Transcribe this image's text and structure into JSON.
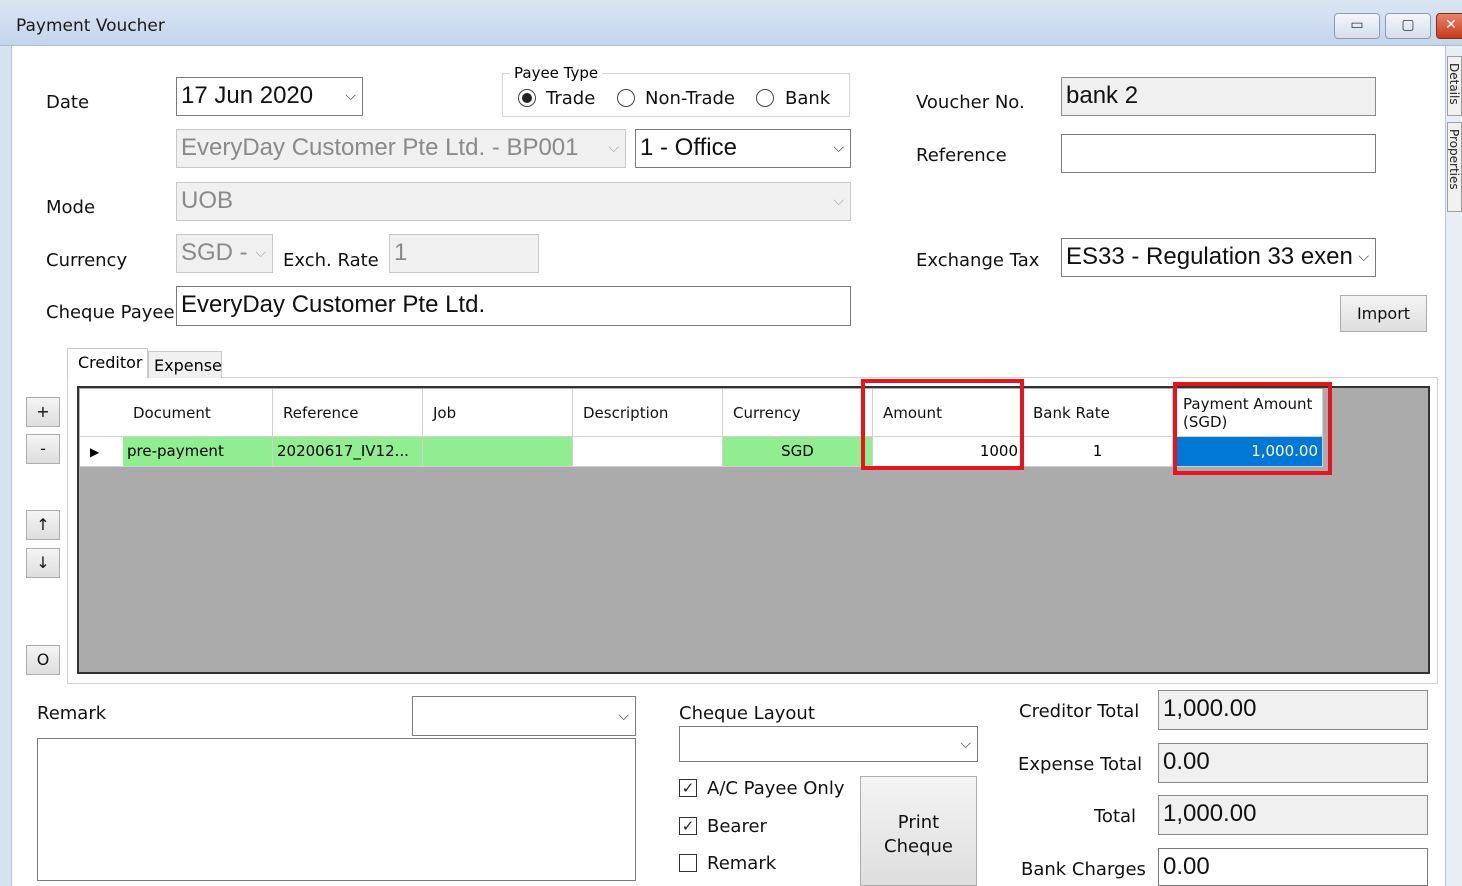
{
  "window": {
    "title": "Payment Voucher"
  },
  "side_tabs": [
    "Details",
    "Properties"
  ],
  "form": {
    "date_label": "Date",
    "date_value": "17 Jun 2020",
    "payee_type": {
      "title": "Payee Type",
      "options": [
        "Trade",
        "Non-Trade",
        "Bank"
      ],
      "selected": "Trade"
    },
    "payee_value": "EveryDay Customer Pte Ltd. - BP001",
    "office_value": "1 - Office",
    "mode_label": "Mode",
    "mode_value": "UOB",
    "currency_label": "Currency",
    "currency_value": "SGD -",
    "exch_rate_label": "Exch. Rate",
    "exch_rate_value": "1",
    "cheque_payee_label": "Cheque Payee",
    "cheque_payee_value": "EveryDay Customer Pte Ltd.",
    "voucher_no_label": "Voucher No.",
    "voucher_no_value": "bank 2",
    "reference_label": "Reference",
    "reference_value": "",
    "exchange_tax_label": "Exchange Tax",
    "exchange_tax_value": "ES33 - Regulation 33 exen",
    "import_label": "Import"
  },
  "tabs": [
    "Creditor",
    "Expense"
  ],
  "side_buttons": [
    "+",
    "-",
    "↑",
    "↓",
    "O"
  ],
  "grid": {
    "columns": [
      "Document",
      "Reference",
      "Job",
      "Description",
      "Currency",
      "Amount",
      "Bank Rate",
      "Payment Amount (SGD)"
    ],
    "rows": [
      {
        "Document": "pre-payment",
        "Reference": "20200617_IV12...",
        "Job": "",
        "Description": "",
        "Currency": "SGD",
        "Amount": "1000",
        "Bank Rate": "1",
        "Payment Amount (SGD)": "1,000.00"
      }
    ]
  },
  "bottom": {
    "remark_label": "Remark",
    "cheque_layout_label": "Cheque Layout",
    "checkboxes": [
      {
        "label": "A/C Payee Only",
        "checked": true
      },
      {
        "label": "Bearer",
        "checked": true
      },
      {
        "label": "Remark",
        "checked": false
      }
    ],
    "print_cheque_label": "Print Cheque",
    "creditor_total_label": "Creditor Total",
    "creditor_total_value": "1,000.00",
    "expense_total_label": "Expense Total",
    "expense_total_value": "0.00",
    "total_label": "Total",
    "total_value": "1,000.00",
    "bank_charges_label": "Bank Charges",
    "bank_charges_value": "0.00"
  },
  "colors": {
    "row_highlight": "#90ee90",
    "selection": "#0078d7",
    "annotation_red": "#e8141c",
    "grid_background": "#ababab"
  }
}
